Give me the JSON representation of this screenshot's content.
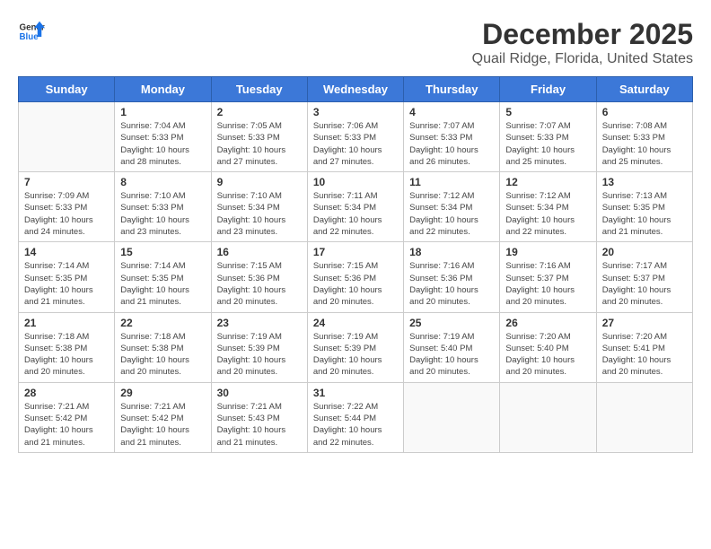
{
  "header": {
    "logo_line1": "General",
    "logo_line2": "Blue",
    "title": "December 2025",
    "subtitle": "Quail Ridge, Florida, United States"
  },
  "days_of_week": [
    "Sunday",
    "Monday",
    "Tuesday",
    "Wednesday",
    "Thursday",
    "Friday",
    "Saturday"
  ],
  "weeks": [
    [
      {
        "day": "",
        "info": ""
      },
      {
        "day": "1",
        "info": "Sunrise: 7:04 AM\nSunset: 5:33 PM\nDaylight: 10 hours\nand 28 minutes."
      },
      {
        "day": "2",
        "info": "Sunrise: 7:05 AM\nSunset: 5:33 PM\nDaylight: 10 hours\nand 27 minutes."
      },
      {
        "day": "3",
        "info": "Sunrise: 7:06 AM\nSunset: 5:33 PM\nDaylight: 10 hours\nand 27 minutes."
      },
      {
        "day": "4",
        "info": "Sunrise: 7:07 AM\nSunset: 5:33 PM\nDaylight: 10 hours\nand 26 minutes."
      },
      {
        "day": "5",
        "info": "Sunrise: 7:07 AM\nSunset: 5:33 PM\nDaylight: 10 hours\nand 25 minutes."
      },
      {
        "day": "6",
        "info": "Sunrise: 7:08 AM\nSunset: 5:33 PM\nDaylight: 10 hours\nand 25 minutes."
      }
    ],
    [
      {
        "day": "7",
        "info": "Sunrise: 7:09 AM\nSunset: 5:33 PM\nDaylight: 10 hours\nand 24 minutes."
      },
      {
        "day": "8",
        "info": "Sunrise: 7:10 AM\nSunset: 5:33 PM\nDaylight: 10 hours\nand 23 minutes."
      },
      {
        "day": "9",
        "info": "Sunrise: 7:10 AM\nSunset: 5:34 PM\nDaylight: 10 hours\nand 23 minutes."
      },
      {
        "day": "10",
        "info": "Sunrise: 7:11 AM\nSunset: 5:34 PM\nDaylight: 10 hours\nand 22 minutes."
      },
      {
        "day": "11",
        "info": "Sunrise: 7:12 AM\nSunset: 5:34 PM\nDaylight: 10 hours\nand 22 minutes."
      },
      {
        "day": "12",
        "info": "Sunrise: 7:12 AM\nSunset: 5:34 PM\nDaylight: 10 hours\nand 22 minutes."
      },
      {
        "day": "13",
        "info": "Sunrise: 7:13 AM\nSunset: 5:35 PM\nDaylight: 10 hours\nand 21 minutes."
      }
    ],
    [
      {
        "day": "14",
        "info": "Sunrise: 7:14 AM\nSunset: 5:35 PM\nDaylight: 10 hours\nand 21 minutes."
      },
      {
        "day": "15",
        "info": "Sunrise: 7:14 AM\nSunset: 5:35 PM\nDaylight: 10 hours\nand 21 minutes."
      },
      {
        "day": "16",
        "info": "Sunrise: 7:15 AM\nSunset: 5:36 PM\nDaylight: 10 hours\nand 20 minutes."
      },
      {
        "day": "17",
        "info": "Sunrise: 7:15 AM\nSunset: 5:36 PM\nDaylight: 10 hours\nand 20 minutes."
      },
      {
        "day": "18",
        "info": "Sunrise: 7:16 AM\nSunset: 5:36 PM\nDaylight: 10 hours\nand 20 minutes."
      },
      {
        "day": "19",
        "info": "Sunrise: 7:16 AM\nSunset: 5:37 PM\nDaylight: 10 hours\nand 20 minutes."
      },
      {
        "day": "20",
        "info": "Sunrise: 7:17 AM\nSunset: 5:37 PM\nDaylight: 10 hours\nand 20 minutes."
      }
    ],
    [
      {
        "day": "21",
        "info": "Sunrise: 7:18 AM\nSunset: 5:38 PM\nDaylight: 10 hours\nand 20 minutes."
      },
      {
        "day": "22",
        "info": "Sunrise: 7:18 AM\nSunset: 5:38 PM\nDaylight: 10 hours\nand 20 minutes."
      },
      {
        "day": "23",
        "info": "Sunrise: 7:19 AM\nSunset: 5:39 PM\nDaylight: 10 hours\nand 20 minutes."
      },
      {
        "day": "24",
        "info": "Sunrise: 7:19 AM\nSunset: 5:39 PM\nDaylight: 10 hours\nand 20 minutes."
      },
      {
        "day": "25",
        "info": "Sunrise: 7:19 AM\nSunset: 5:40 PM\nDaylight: 10 hours\nand 20 minutes."
      },
      {
        "day": "26",
        "info": "Sunrise: 7:20 AM\nSunset: 5:40 PM\nDaylight: 10 hours\nand 20 minutes."
      },
      {
        "day": "27",
        "info": "Sunrise: 7:20 AM\nSunset: 5:41 PM\nDaylight: 10 hours\nand 20 minutes."
      }
    ],
    [
      {
        "day": "28",
        "info": "Sunrise: 7:21 AM\nSunset: 5:42 PM\nDaylight: 10 hours\nand 21 minutes."
      },
      {
        "day": "29",
        "info": "Sunrise: 7:21 AM\nSunset: 5:42 PM\nDaylight: 10 hours\nand 21 minutes."
      },
      {
        "day": "30",
        "info": "Sunrise: 7:21 AM\nSunset: 5:43 PM\nDaylight: 10 hours\nand 21 minutes."
      },
      {
        "day": "31",
        "info": "Sunrise: 7:22 AM\nSunset: 5:44 PM\nDaylight: 10 hours\nand 22 minutes."
      },
      {
        "day": "",
        "info": ""
      },
      {
        "day": "",
        "info": ""
      },
      {
        "day": "",
        "info": ""
      }
    ]
  ]
}
